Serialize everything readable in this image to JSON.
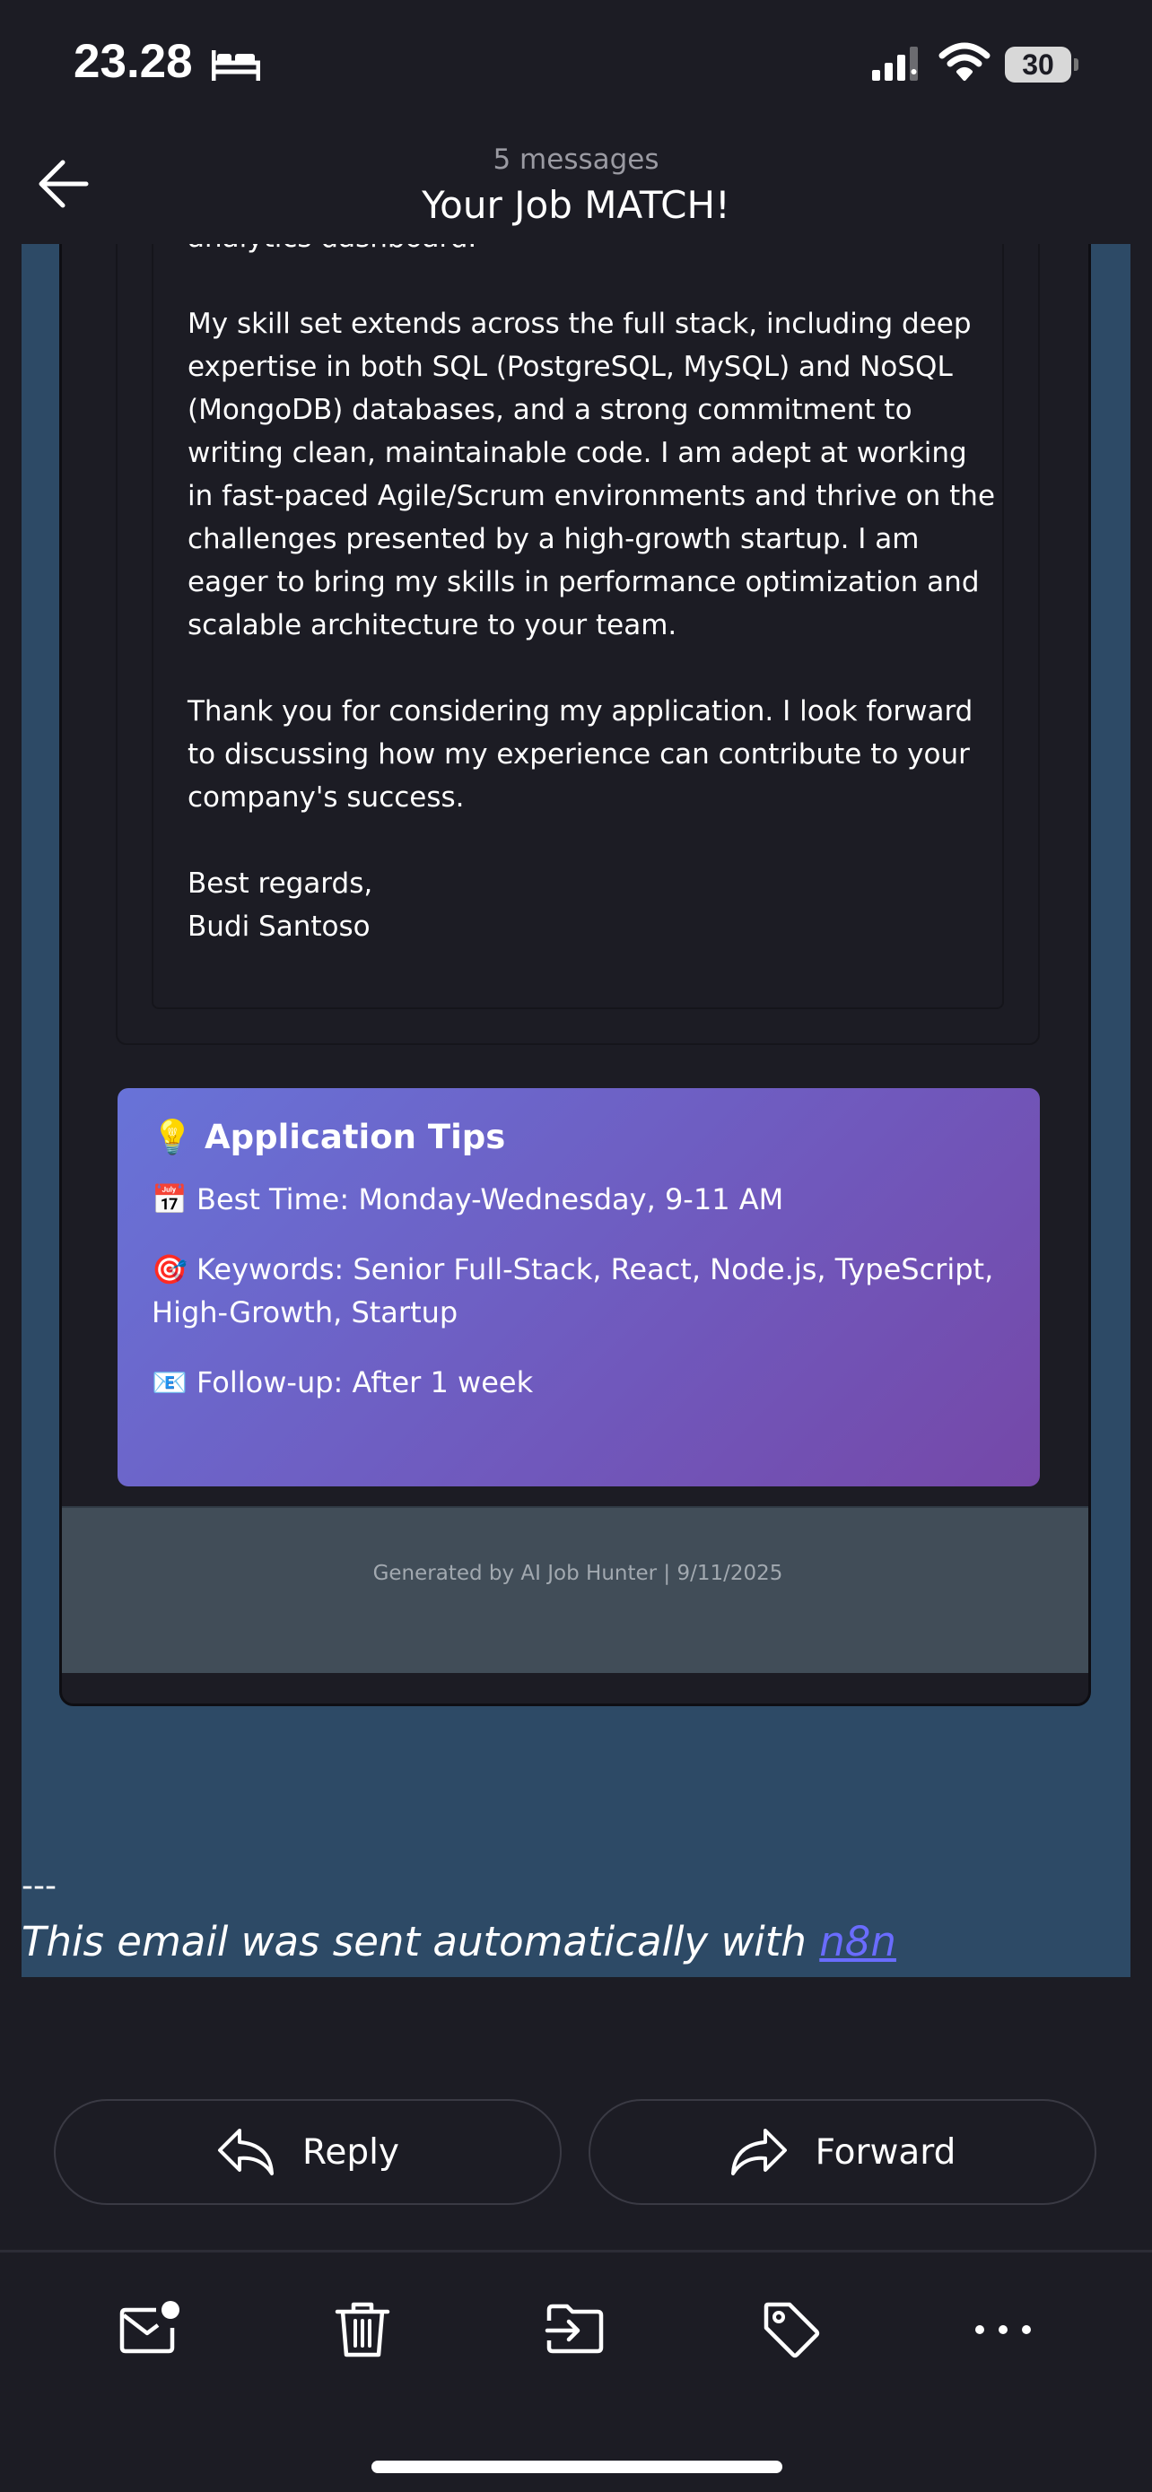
{
  "status_bar": {
    "time": "23.28",
    "battery": "30"
  },
  "header": {
    "message_count": "5 messages",
    "title": "Your Job MATCH!"
  },
  "letter": {
    "line_0": "analytics dashboard.",
    "paragraph_skills": "My skill set extends across the full stack, including deep expertise in both SQL (PostgreSQL, MySQL) and NoSQL (MongoDB) databases, and a strong commitment to writing clean, maintainable code. I am adept at working in fast-paced Agile/Scrum environments and thrive on the challenges presented by a high-growth startup. I am eager to bring my skills in performance optimization and scalable architecture to your team.",
    "paragraph_thanks": "Thank you for considering my application. I look forward to discussing how my experience can contribute to your company's success.",
    "closing": "Best regards,",
    "name": "Budi Santoso"
  },
  "tips": {
    "title_icon": "💡",
    "title": "Application Tips",
    "best_time": "📅 Best Time: Monday-Wednesday, 9-11 AM",
    "keywords": "🎯 Keywords: Senior Full-Stack, React, Node.js, TypeScript, High-Growth, Startup",
    "followup": "📧 Follow-up: After 1 week"
  },
  "footer": {
    "text": "Generated by AI Job Hunter | 9/11/2025"
  },
  "signature": {
    "dashes": "---",
    "text": "This email was sent automatically with ",
    "link": "n8n"
  },
  "actions": {
    "reply": "Reply",
    "forward": "Forward"
  },
  "toolbar": {
    "icons": [
      "mail-unread-icon",
      "trash-icon",
      "move-to-folder-icon",
      "tag-icon",
      "more-icon"
    ]
  }
}
